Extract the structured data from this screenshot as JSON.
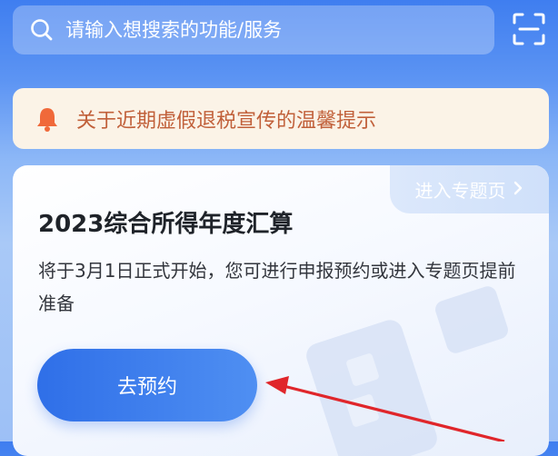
{
  "search": {
    "placeholder": "请输入想搜索的功能/服务"
  },
  "notice": {
    "text": "关于近期虚假退税宣传的温馨提示",
    "color": "#c1603a"
  },
  "card": {
    "topic_link": "进入专题页",
    "title": "2023综合所得年度汇算",
    "description": "将于3月1日正式开始，您可进行申报预约或进入专题页提前准备",
    "button_label": "去预约"
  },
  "colors": {
    "accent": "#3a7bef",
    "annotation_arrow": "#e0262b"
  },
  "icons": {
    "search": "search-icon",
    "scan": "scan-icon",
    "notice": "bell-icon",
    "link": "chevron-right-icon"
  }
}
